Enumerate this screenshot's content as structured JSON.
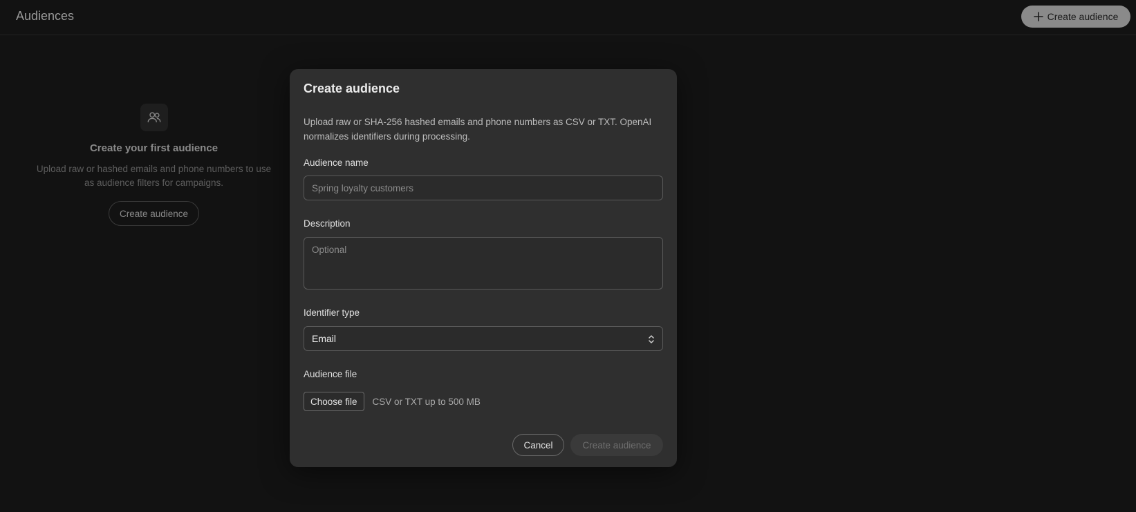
{
  "header": {
    "title": "Audiences",
    "create_button_label": "Create audience"
  },
  "empty_state": {
    "icon": "users-icon",
    "title": "Create your first audience",
    "description": "Upload raw or hashed emails and phone numbers to use as audience filters for campaigns.",
    "button_label": "Create audience"
  },
  "modal": {
    "title": "Create audience",
    "description": "Upload raw or SHA-256 hashed emails and phone numbers as CSV or TXT. OpenAI normalizes identifiers during processing.",
    "fields": {
      "name": {
        "label": "Audience name",
        "value": "",
        "placeholder": "Spring loyalty customers"
      },
      "description": {
        "label": "Description",
        "value": "",
        "placeholder": "Optional"
      },
      "identifier_type": {
        "label": "Identifier type",
        "selected": "Email"
      },
      "file": {
        "label": "Audience file",
        "choose_label": "Choose file",
        "hint": "CSV or TXT up to 500 MB"
      }
    },
    "cancel_label": "Cancel",
    "submit_label": "Create audience"
  }
}
